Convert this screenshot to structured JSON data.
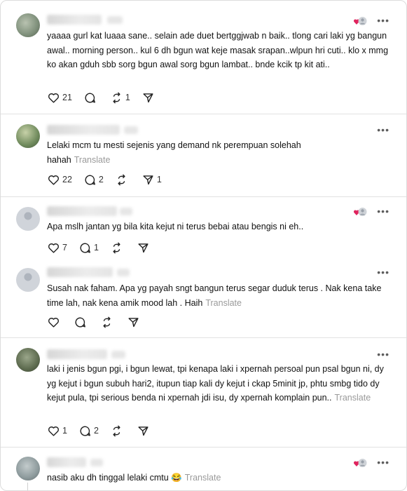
{
  "posts": [
    {
      "text": "yaaaa gurl kat luaaa sane.. selain ade duet bertggjwab n baik.. tlong cari laki yg bangun awal.. morning person.. kul 6 dh bgun wat keje masak srapan..wlpun hri cuti.. klo x mmg ko akan gduh sbb sorg bgun awal sorg bgun lambat.. bnde kcik tp kit ati..",
      "translate": "",
      "likes": "21",
      "replies": "",
      "reposts": "1",
      "shares": "",
      "badge": true,
      "avatar": "#7e8f7a"
    },
    {
      "text": "Lelaki mcm tu mesti sejenis yang demand nk perempuan solehah hahah",
      "translate": "Translate",
      "likes": "22",
      "replies": "2",
      "reposts": "",
      "shares": "1",
      "badge": false,
      "avatar": "#6f8a5c"
    },
    {
      "text": "Apa mslh jantan yg bila kita kejut ni terus bebai atau bengis ni eh..",
      "translate": "",
      "likes": "7",
      "replies": "1",
      "reposts": "",
      "shares": "",
      "badge": true,
      "avatar": "#c9ced6"
    },
    {
      "text": "Susah nak faham. Apa yg payah sngt bangun terus segar duduk terus . Nak kena take time lah, nak kena amik mood lah . Haih",
      "translate": "Translate",
      "likes": "",
      "replies": "",
      "reposts": "",
      "shares": "",
      "badge": false,
      "avatar": "#c9ced6"
    },
    {
      "text": "laki i jenis bgun pgi, i bgun lewat, tpi kenapa laki i xpernah persoal pun psal bgun ni, dy yg kejut i bgun subuh hari2, itupun tiap kali dy kejut i ckap 5minit jp, phtu smbg tido dy kejut pula, tpi serious benda ni xpernah jdi isu, dy xpernah komplain pun..",
      "translate": "Translate",
      "likes": "1",
      "replies": "2",
      "reposts": "",
      "shares": "",
      "badge": false,
      "avatar": "#5d6b4f"
    },
    {
      "text": "nasib aku dh tinggal lelaki cmtu 😂",
      "translate": "Translate",
      "likes": "",
      "replies": "",
      "reposts": "",
      "shares": "",
      "badge": true,
      "avatar": "#8d9a9c"
    }
  ],
  "more_icon": "more-horizontal-icon",
  "colors": {
    "text": "#111111",
    "muted": "#9a9a9a",
    "divider": "#e2e2e2",
    "heart": "#e0245e"
  }
}
